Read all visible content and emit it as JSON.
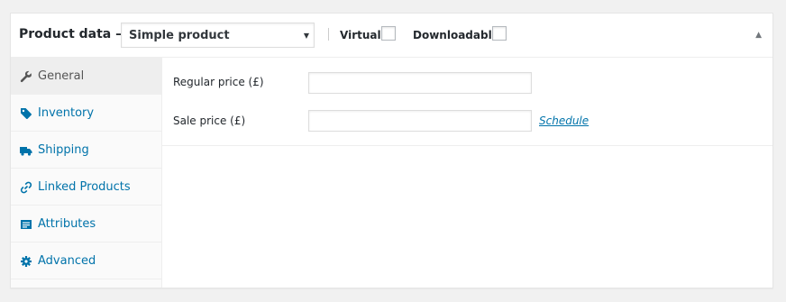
{
  "header": {
    "title": "Product data —",
    "product_type": {
      "selected": "Simple product",
      "arrow": "▼"
    },
    "virtual_label": "Virtual:",
    "downloadable_label": "Downloadable:",
    "collapse_glyph": "▲"
  },
  "tabs": [
    {
      "label": "General",
      "icon": "wrench-icon",
      "active": true
    },
    {
      "label": "Inventory",
      "icon": "tag-icon",
      "active": false
    },
    {
      "label": "Shipping",
      "icon": "truck-icon",
      "active": false
    },
    {
      "label": "Linked Products",
      "icon": "link-icon",
      "active": false
    },
    {
      "label": "Attributes",
      "icon": "list-icon",
      "active": false
    },
    {
      "label": "Advanced",
      "icon": "gear-icon",
      "active": false
    }
  ],
  "general": {
    "regular_price_label": "Regular price (£)",
    "regular_price_value": "",
    "sale_price_label": "Sale price (£)",
    "sale_price_value": "",
    "schedule_link": "Schedule"
  },
  "colors": {
    "link": "#0073aa",
    "active_tab_text": "#555555",
    "panel_bg": "#ffffff",
    "page_bg": "#f1f1f1"
  }
}
